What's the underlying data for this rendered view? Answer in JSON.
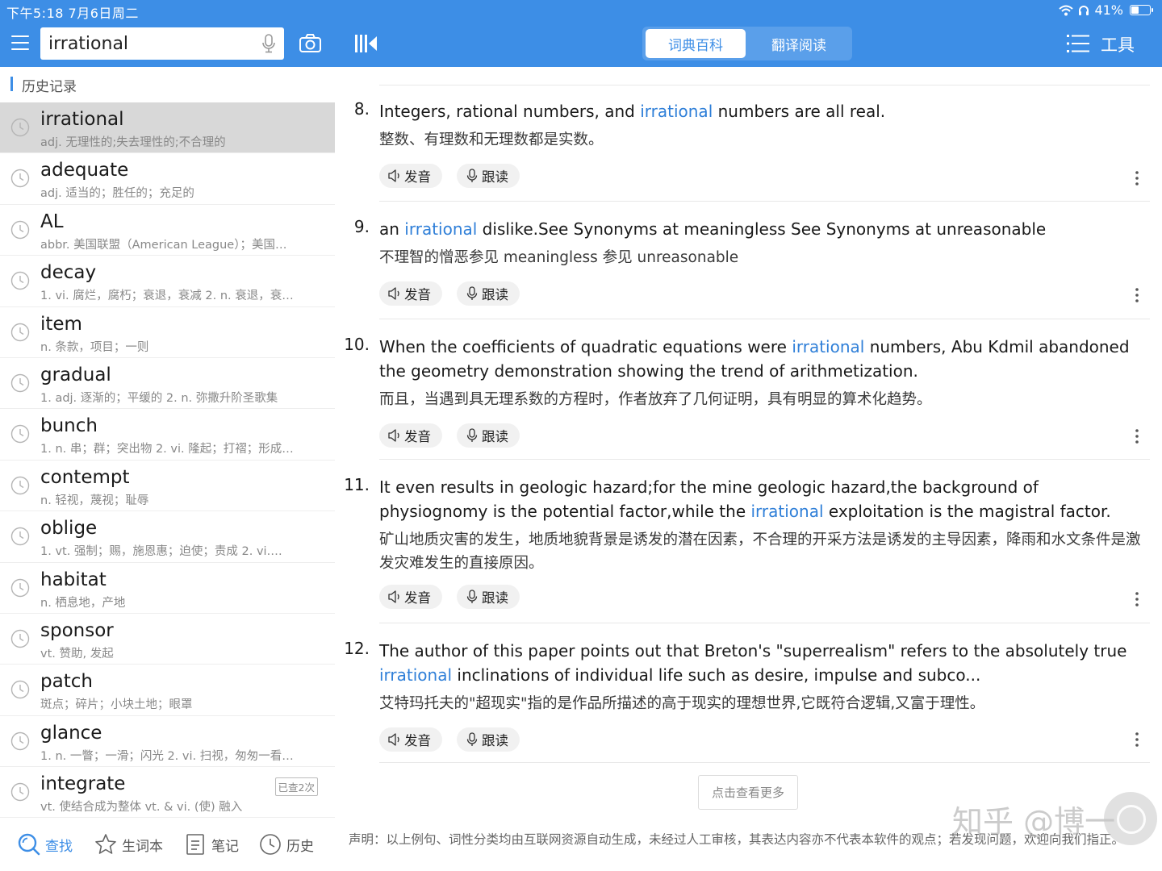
{
  "status": {
    "time": "下午5:18   7月6日周二",
    "battery": "41%",
    "battery_level": 0.41
  },
  "header": {
    "search_value": "irrational",
    "tabs": [
      {
        "label": "词典百科",
        "active": true
      },
      {
        "label": "翻译阅读",
        "active": false
      }
    ],
    "tools_label": "工具"
  },
  "sidebar": {
    "section_title": "历史记录",
    "items": [
      {
        "word": "irrational",
        "def": "adj. 无理性的;失去理性的;不合理的",
        "selected": true
      },
      {
        "word": "adequate",
        "def": "adj. 适当的；胜任的；充足的"
      },
      {
        "word": "AL",
        "def": "abbr. 美国联盟（American League）；美国…"
      },
      {
        "word": "decay",
        "def": "1. vi. 腐烂，腐朽；衰退，衰减 2. n. 衰退，衰…"
      },
      {
        "word": "item",
        "def": "n. 条款，项目；一则"
      },
      {
        "word": "gradual",
        "def": "1. adj. 逐渐的；平缓的 2. n. 弥撒升阶圣歌集"
      },
      {
        "word": "bunch",
        "def": "1. n. 串；群；突出物 2. vi. 隆起；打褶；形成…"
      },
      {
        "word": "contempt",
        "def": "n. 轻视，蔑视；耻辱"
      },
      {
        "word": "oblige",
        "def": "1. vt. 强制；赐，施恩惠；迫使；责成 2. vi.…"
      },
      {
        "word": "habitat",
        "def": "n. 栖息地，产地"
      },
      {
        "word": "sponsor",
        "def": "vt. 赞助, 发起"
      },
      {
        "word": "patch",
        "def": "斑点；碎片；小块土地；眼罩"
      },
      {
        "word": "glance",
        "def": "1. n. 一瞥；一滑；闪光 2. vi. 扫视，匆匆一看…"
      },
      {
        "word": "integrate",
        "def": "vt. 使结合成为整体 vt. & vi. (使) 融入",
        "badge": "已查2次"
      }
    ],
    "nav": [
      {
        "label": "查找",
        "icon": "search-icon",
        "active": true
      },
      {
        "label": "生词本",
        "icon": "star-icon"
      },
      {
        "label": "笔记",
        "icon": "note-icon"
      },
      {
        "label": "历史",
        "icon": "clock-icon"
      }
    ]
  },
  "main": {
    "pronounce_label": "发音",
    "follow_label": "跟读",
    "examples": [
      {
        "num": "8.",
        "en_parts": [
          "Integers, rational numbers, and ",
          "irrational",
          " numbers are all real."
        ],
        "zh": "整数、有理数和无理数都是实数。"
      },
      {
        "num": "9.",
        "en_parts": [
          "an ",
          "irrational",
          " dislike.See Synonyms at meaningless See Synonyms at unreasonable"
        ],
        "zh": "不理智的憎恶参见 meaningless 参见 unreasonable"
      },
      {
        "num": "10.",
        "en_parts": [
          "When the coefficients of quadratic equations were ",
          "irrational",
          " numbers, Abu Kdmil abandoned the geometry demonstration showing the trend of arithmetization."
        ],
        "zh": "而且，当遇到具无理系数的方程时，作者放弃了几何证明，具有明显的算术化趋势。"
      },
      {
        "num": "11.",
        "en_parts": [
          "It even results in geologic hazard;for the mine geologic hazard,the background of physiognomy is the potential factor,while the ",
          "irrational",
          " exploitation is the magistral factor."
        ],
        "zh": "矿山地质灾害的发生，地质地貌背景是诱发的潜在因素，不合理的开采方法是诱发的主导因素，降雨和水文条件是激发灾难发生的直接原因。"
      },
      {
        "num": "12.",
        "en_parts": [
          "The author of this paper points out that Breton's \"superrealism\" refers to the absolutely true ",
          "irrational",
          " inclinations of individual life such as desire, impulse and subco..."
        ],
        "zh": "艾特玛托夫的\"超现实\"指的是作品所描述的高于现实的理想世界,它既符合逻辑,又富于理性。"
      }
    ],
    "see_more": "点击查看更多",
    "disclaimer": "声明：以上例句、词性分类均由互联网资源自动生成，未经过人工审核，其表达内容亦不代表本软件的观点；若发现问题，欢迎向我们指正。"
  },
  "watermark": "知乎 @博一"
}
